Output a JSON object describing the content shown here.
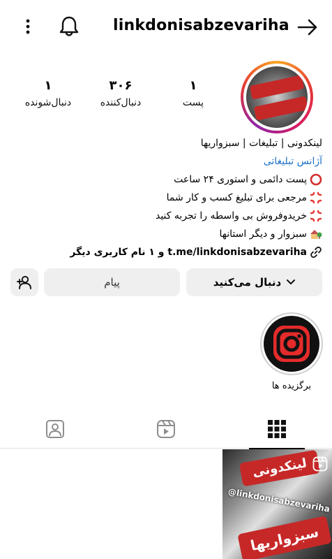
{
  "header": {
    "username": "linkdonisabzevariha",
    "more_icon": "vertical-dots-icon",
    "bell_icon": "bell-icon",
    "back_icon": "arrow-right-icon"
  },
  "stats": {
    "posts": {
      "value": "۱",
      "label": "پست"
    },
    "followers": {
      "value": "۳۰۶",
      "label": "دنبال‌کننده"
    },
    "following": {
      "value": "۱",
      "label": "دنبال‌شونده"
    }
  },
  "bio": {
    "name": "لینکدونی | تبلیغات | سبزواریها",
    "category": "آژانس تبلیغاتی",
    "lines": [
      "پست دائمی و استوری ۲۴ ساعت",
      "مرجعی برای تبلیغ کسب و کار شما",
      "خریدوفروش بی واسطه را تجربه کنید",
      "سبزوار و دیگر استانها"
    ],
    "link_text": "t.me/linkdonisabzevariha",
    "link_suffix": "و ۱ نام کاربری دیگر"
  },
  "actions": {
    "follow_label": "دنبال می‌کنید",
    "message_label": "پیام"
  },
  "highlight": {
    "label": "برگزیده ها"
  },
  "post": {
    "line1": "لینکدونی",
    "line2": "@linkdonisabzevariha",
    "line3": "سبزواریها"
  },
  "colors": {
    "accent_blue": "#1e70c8",
    "brand_red": "#c62828",
    "button_bg": "#efefef"
  }
}
